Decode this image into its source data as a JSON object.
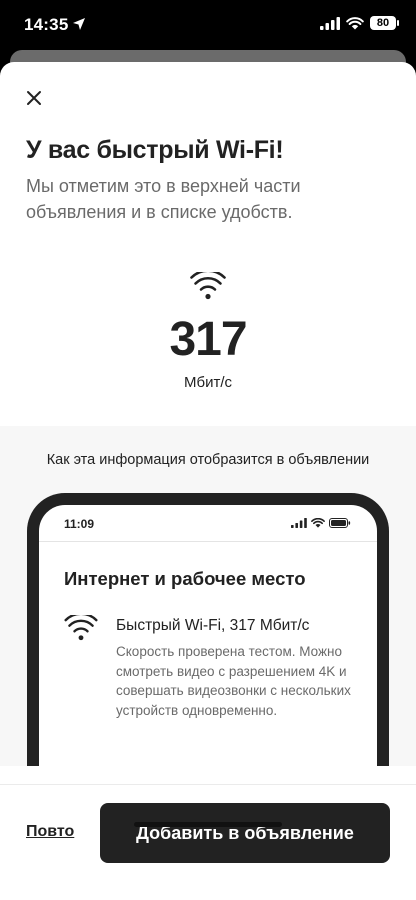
{
  "status_bar": {
    "time": "14:35",
    "battery": "80"
  },
  "modal": {
    "title": "У вас быстрый Wi‑Fi!",
    "subtitle": "Мы отметим это в верхней части объявления и в списке удобств.",
    "speed_value": "317",
    "speed_unit": "Мбит/с"
  },
  "preview": {
    "caption": "Как эта информация отобразится в объявлении",
    "phone_time": "11:09",
    "section_title": "Интернет и рабочее место",
    "feature_title": "Быстрый Wi‑Fi, 317 Мбит/с",
    "feature_description": "Скорость проверена тестом. Можно смотреть видео с разрешением 4K и совершать видеозвонки с нескольких устройств одновременно."
  },
  "footer": {
    "repeat_label": "Повто",
    "add_button_label": "Добавить в объявление"
  },
  "icons": [
    "location-arrow-icon",
    "cellular-signal-icon",
    "wifi-icon",
    "battery-icon",
    "close-icon"
  ]
}
